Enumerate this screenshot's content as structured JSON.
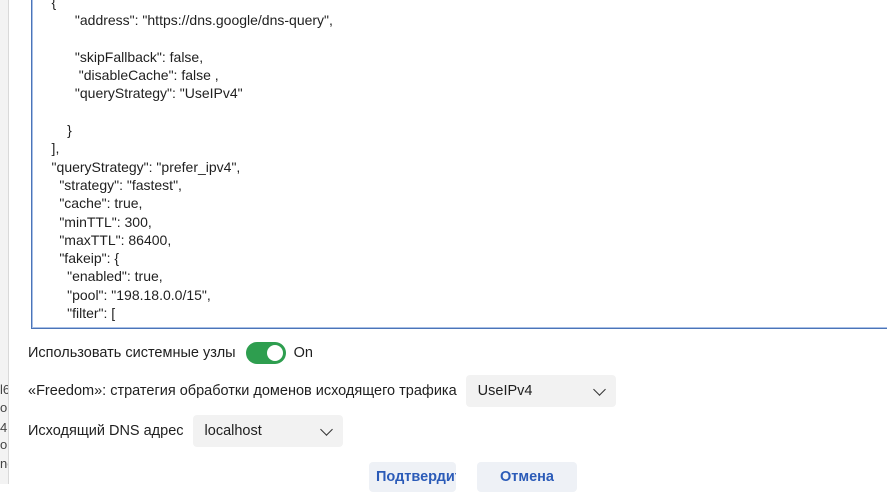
{
  "editor": {
    "lines": [
      "    {",
      "          \"address\": \"https://dns.google/dns-query\",",
      "",
      "          \"skipFallback\": false,",
      "           \"disableCache\": false ,",
      "          \"queryStrategy\": \"UseIPv4\"",
      "",
      "        }",
      "    ],",
      "    \"queryStrategy\": \"prefer_ipv4\",",
      "      \"strategy\": \"fastest\",",
      "      \"cache\": true,",
      "      \"minTTL\": 300,",
      "      \"maxTTL\": 86400,",
      "      \"fakeip\": {",
      "        \"enabled\": true,",
      "        \"pool\": \"198.18.0.0/15\",",
      "        \"filter\": ["
    ]
  },
  "system_hosts": {
    "label": "Использовать системные узлы",
    "toggle_state": "On"
  },
  "freedom": {
    "label": "«Freedom»: стратегия обработки доменов исходящего трафика",
    "value": "UseIPv4"
  },
  "outbound_dns": {
    "label": "Исходящий DNS адрес",
    "value": "localhost"
  },
  "buttons": {
    "confirm": "Подтвердить",
    "cancel": "Отмена"
  },
  "left_strip": {
    "glyphs": [
      "l6",
      "ol",
      "4",
      "ol",
      "ne"
    ]
  }
}
